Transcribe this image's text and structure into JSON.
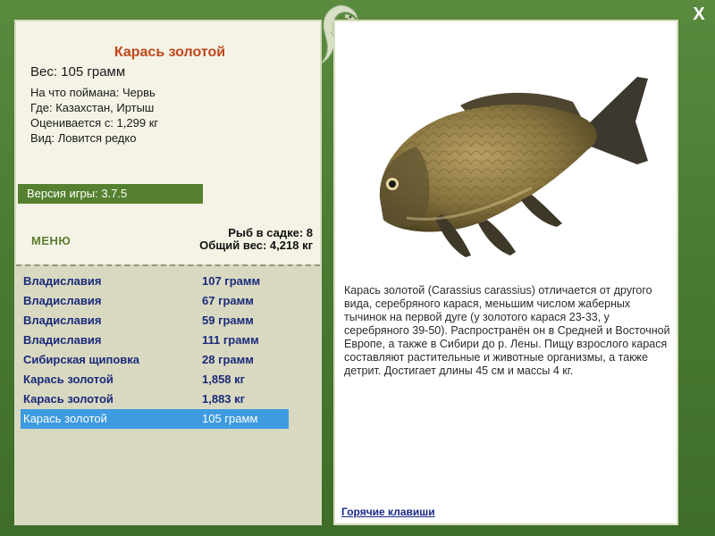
{
  "fish": {
    "name": "Карась золотой",
    "weight": "Вес: 105 грамм",
    "caught_on": "На что поймана: Червь",
    "location": "Где: Казахстан, Иртыш",
    "rated_from": "Оценивается с: 1,299 кг",
    "rarity": "Вид: Ловится редко"
  },
  "game_version": "Версия игры: 3.7.5",
  "menu_label": "МЕНЮ",
  "net": {
    "count": "Рыб в садке: 8",
    "total_weight": "Общий вес: 4,218 кг"
  },
  "catch_list": [
    {
      "name": "Владиславия",
      "weight": "107 грамм"
    },
    {
      "name": "Владиславия",
      "weight": "67 грамм"
    },
    {
      "name": "Владиславия",
      "weight": "59 грамм"
    },
    {
      "name": "Владиславия",
      "weight": "111 грамм"
    },
    {
      "name": "Сибирская щиповка",
      "weight": "28 грамм"
    },
    {
      "name": "Карась золотой",
      "weight": "1,858 кг"
    },
    {
      "name": "Карась золотой",
      "weight": "1,883 кг"
    },
    {
      "name": "Карась золотой",
      "weight": "105 грамм"
    }
  ],
  "selected_index": 7,
  "description": "Карась золотой (Carassius carassius) отличается от другого вида, серебряного карася, меньшим числом жаберных тычинок на первой дуге (у золотого карася 23-33, у серебряного 39-50). Распространён он в Средней и Восточной Европе, а также в Сибири до р. Лены. Пищу взрослого карася составляют растительные и животные организмы, а также детрит. Достигает длины 45 см и массы 4 кг.",
  "hotkeys_label": "Горячие клавиши",
  "close_label": "X",
  "colors": {
    "background": "#4d7a35",
    "title": "#c0471a",
    "list_text": "#1a2a7a",
    "selected_row": "#3d9be0"
  }
}
